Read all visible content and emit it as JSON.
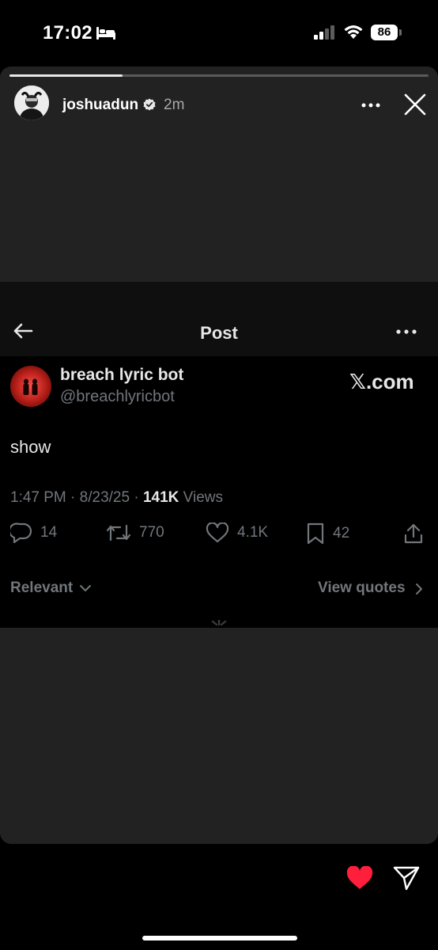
{
  "status_bar": {
    "time": "17:02",
    "battery": "86",
    "icons": [
      "bed-icon",
      "signal-icon",
      "wifi-icon",
      "battery-icon"
    ]
  },
  "story": {
    "username": "joshuadun",
    "time_ago": "2m",
    "verified": true,
    "progress": 0.27,
    "icons": [
      "verified-icon",
      "more-icon",
      "close-icon"
    ]
  },
  "post": {
    "header_title": "Post",
    "author_name": "breach lyric bot",
    "author_handle": "@breachlyricbot",
    "source_logo_mark": "𝕏",
    "source_logo_text": ".com",
    "text": "show",
    "time": "1:47 PM",
    "date": "8/23/25",
    "views_count": "141K",
    "views_label": "Views",
    "replies": "14",
    "reposts": "770",
    "likes": "4.1K",
    "bookmarks": "42",
    "sort_label": "Relevant",
    "view_quotes_label": "View quotes",
    "icons": [
      "back-arrow-icon",
      "more-icon",
      "reply-icon",
      "repost-icon",
      "like-icon",
      "bookmark-icon",
      "share-icon",
      "chevron-down-icon",
      "chevron-right-icon",
      "loading-spinner-icon"
    ]
  },
  "bottom": {
    "icons": [
      "heart-icon",
      "send-icon"
    ]
  },
  "colors": {
    "background": "#000000",
    "story_card": "#222222",
    "muted_text": "#71767b",
    "heart": "#ff1f3d"
  }
}
